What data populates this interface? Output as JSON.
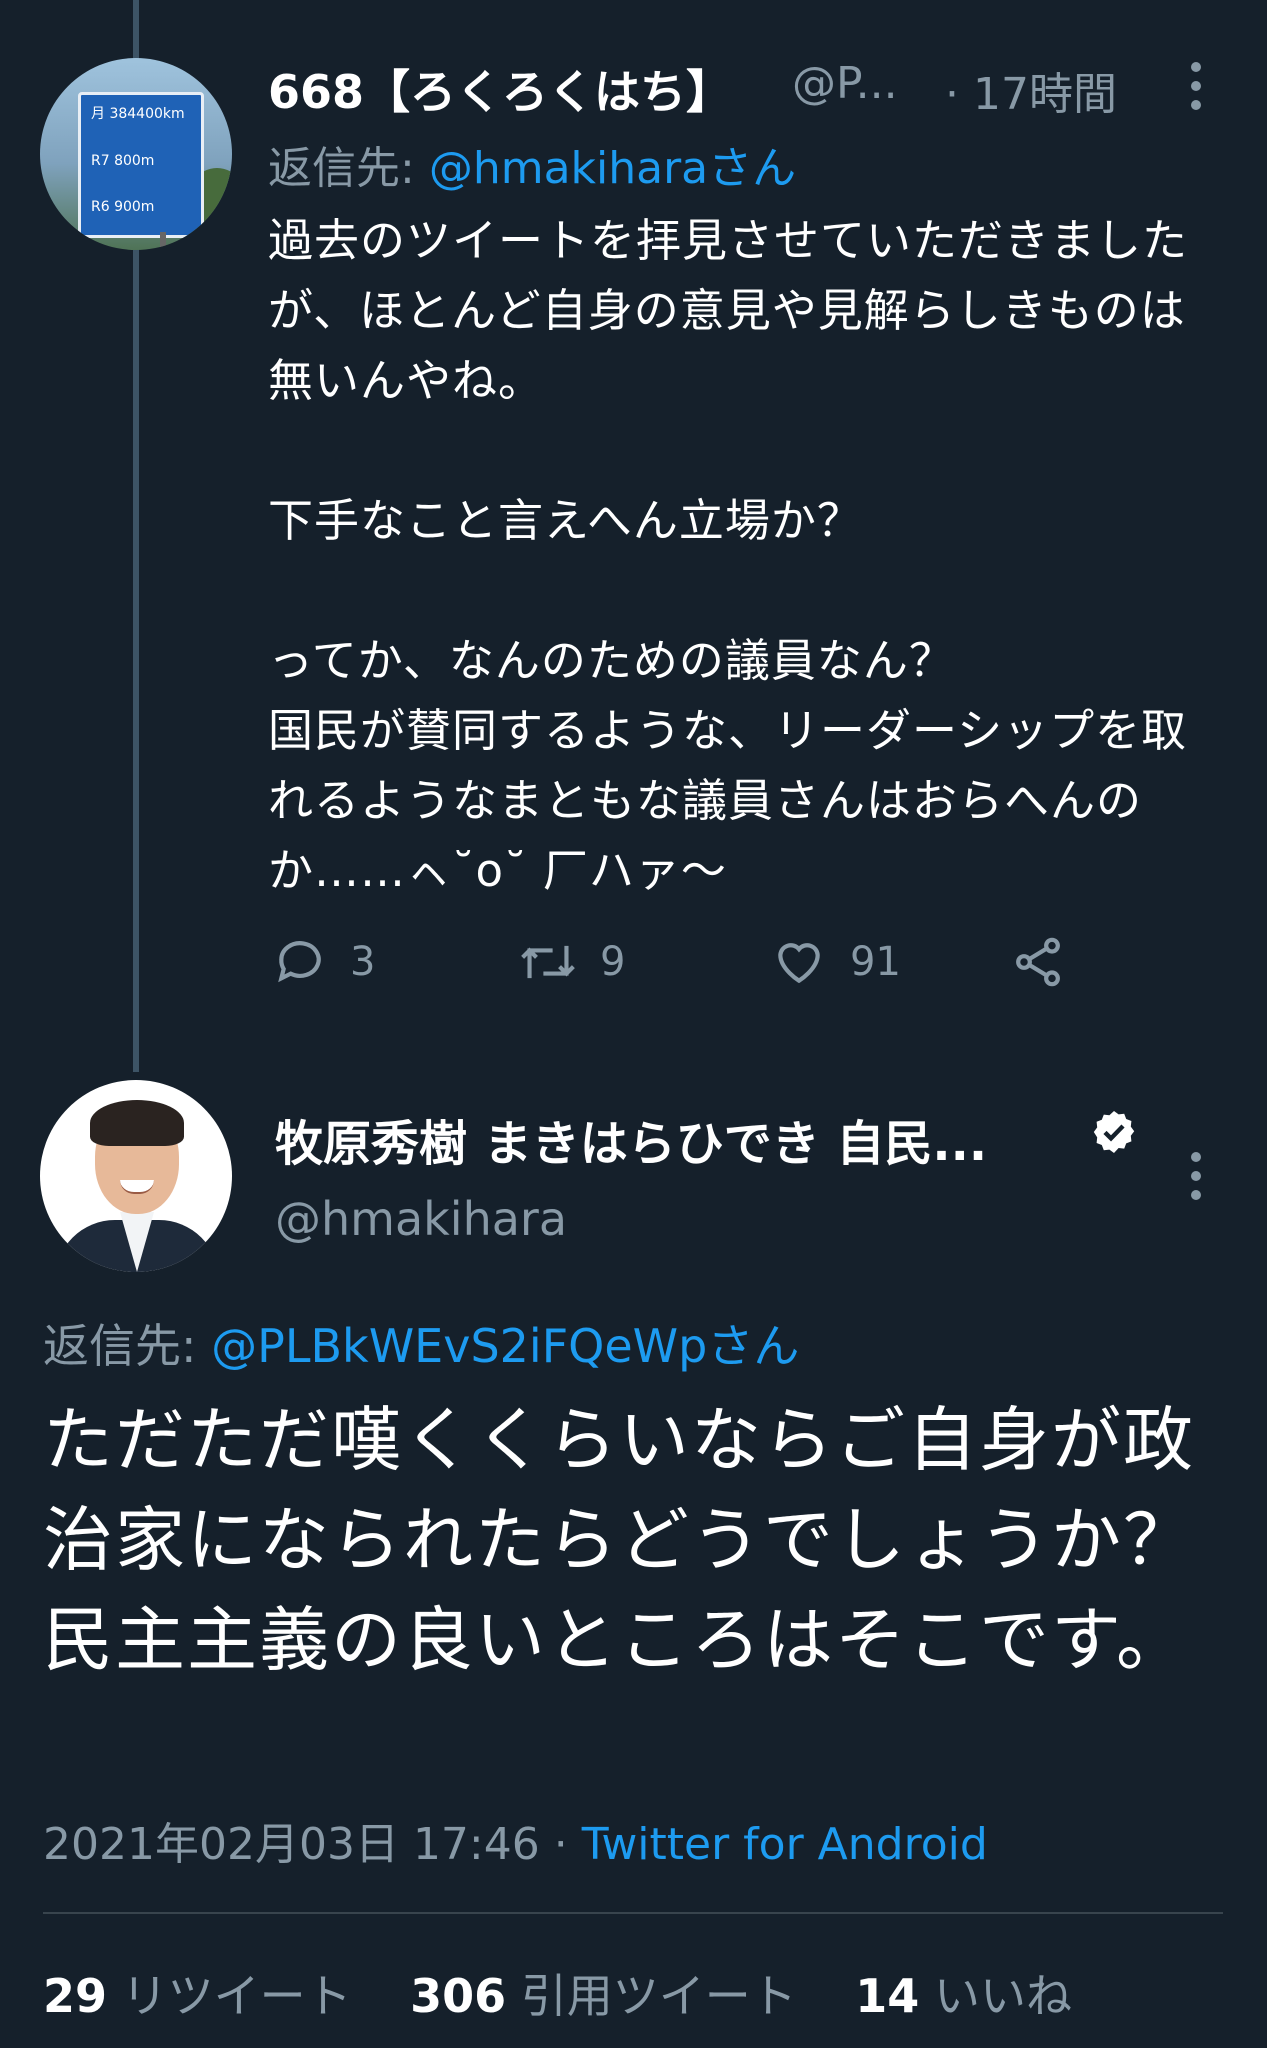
{
  "tweet1": {
    "name": "668【ろくろくはち】",
    "handle": "@P...",
    "time": "· 17時間",
    "reply_prefix": "返信先:",
    "reply_to": "@hmakiharaさん",
    "body": "過去のツイートを拝見させていただきましたが、ほとんど自身の意見や見解らしきものは無いんやね。\n\n下手なこと言えへん立場か？\n\nってか、なんのための議員なん？\n国民が賛同するような、リーダーシップを取れるようなまともな議員さんはおらへんのか……ㇸ˘o˘ 厂ハァ〜",
    "replies": "3",
    "retweets": "9",
    "likes": "91",
    "avatar_sign": {
      "row1": "月 384400km",
      "row2": "R7    800m",
      "row3": "R6    900m"
    }
  },
  "tweet2": {
    "name": "牧原秀樹 まきはらひでき 自民...",
    "handle": "@hmakihara",
    "reply_prefix": "返信先:",
    "reply_to": "@PLBkWEvS2iFQeWpさん",
    "body": "ただただ嘆くくらいならご自身が政治家になられたらどうでしょうか？民主主義の良いところはそこです。",
    "timestamp": "2021年02月03日 17:46 ·",
    "source": "Twitter for Android",
    "retweet_count": "29",
    "retweet_label": "リツイート",
    "quote_count": "306",
    "quote_label": "引用ツイート",
    "like_count": "14",
    "like_label": "いいね"
  },
  "colors": {
    "background": "#15202b",
    "link": "#1d9bf0",
    "muted": "#8899a6",
    "divider": "#38444d"
  }
}
